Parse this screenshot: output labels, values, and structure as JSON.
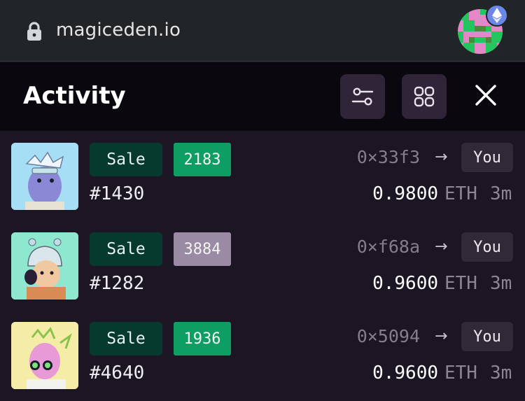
{
  "browser": {
    "url": "magiceden.io",
    "lock_icon": "lock-icon",
    "avatar_icon": "pixel-avatar",
    "badge_icon": "ethereum-icon"
  },
  "header": {
    "title": "Activity",
    "filter_icon": "filter-sliders-icon",
    "grid_icon": "grid-icon",
    "close_icon": "close-icon"
  },
  "colors": {
    "background": "#1c1524",
    "header": "#0a080e",
    "sale_badge": "#063a2f",
    "rank_green": "#0e9e64",
    "rank_purple": "#9a8aa3"
  },
  "activity": [
    {
      "type": "Sale",
      "rank": "2183",
      "rank_color": "#0e9e64",
      "token": "#1430",
      "from": "0×33f3",
      "to": "You",
      "price": "0.9800",
      "currency": "ETH",
      "time": "3m",
      "thumb_bg": "#a6dff5"
    },
    {
      "type": "Sale",
      "rank": "3884",
      "rank_color": "#9a8aa3",
      "token": "#1282",
      "from": "0×f68a",
      "to": "You",
      "price": "0.9600",
      "currency": "ETH",
      "time": "3m",
      "thumb_bg": "#8ee8cf"
    },
    {
      "type": "Sale",
      "rank": "1936",
      "rank_color": "#0e9e64",
      "token": "#4640",
      "from": "0×5094",
      "to": "You",
      "price": "0.9600",
      "currency": "ETH",
      "time": "3m",
      "thumb_bg": "#f5eda7"
    }
  ]
}
